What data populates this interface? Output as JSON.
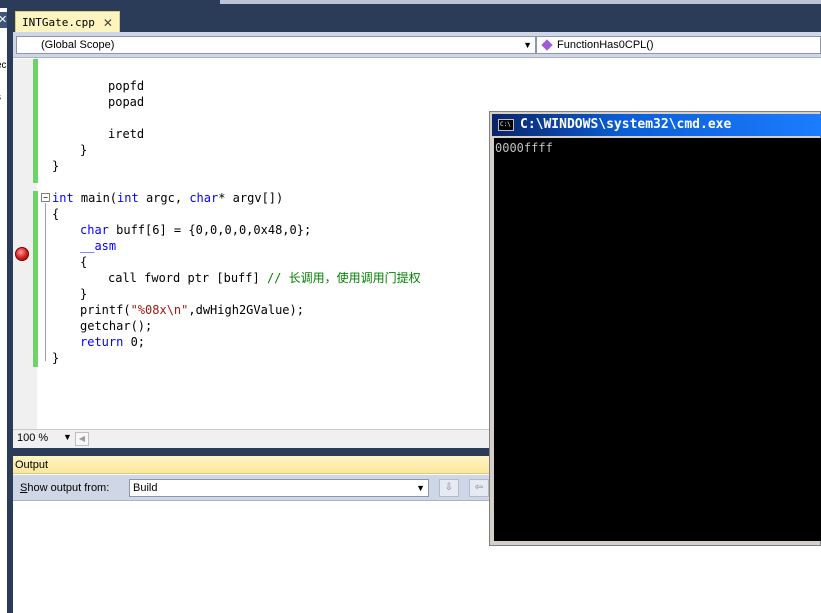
{
  "tab": {
    "label": "INTGate.cpp",
    "close": "✕"
  },
  "side_panel": {
    "close": "✕",
    "frag1": "ec",
    "frag2": "s"
  },
  "navbar": {
    "scope": "(Global Scope)",
    "function": "FunctionHas0CPL()"
  },
  "code": {
    "l1": "popfd",
    "l2": "popad",
    "l3": "iretd",
    "l4": "}",
    "l5": "}",
    "main_kw": "int",
    "main_rest1": " main(",
    "main_kw2": "int",
    "main_rest2": " argc, ",
    "main_kw3": "char",
    "main_rest3": "* argv[])",
    "open": "{",
    "buff_kw": "char",
    "buff_rest": " buff[6] = {0,0,0,0,0x48,0};",
    "asm_kw": "__asm",
    "asm_open": "{",
    "call_code": "call fword ptr [buff] ",
    "call_comment": "// 长调用，使用调用门提权",
    "asm_close": "}",
    "printf_a": "printf(",
    "printf_str": "\"%08x\\n\"",
    "printf_b": ",dwHigh2GValue);",
    "getchar": "getchar();",
    "return_kw": "return",
    "return_rest": " 0;",
    "close": "}"
  },
  "statusbar": {
    "zoom": "100 %"
  },
  "output": {
    "title": "Output",
    "show_label_u": "S",
    "show_label_rest": "how output from:",
    "source": "Build"
  },
  "console": {
    "title": "C:\\WINDOWS\\system32\\cmd.exe",
    "icon": "C:\\",
    "text": "0000ffff"
  }
}
